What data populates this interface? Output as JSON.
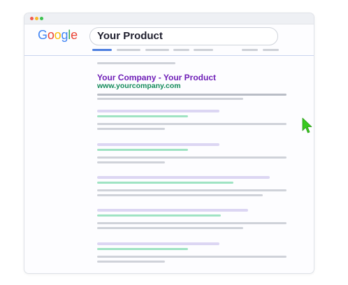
{
  "logo": {
    "letters": [
      "G",
      "o",
      "o",
      "g",
      "l",
      "e"
    ],
    "colors": [
      "#4285F4",
      "#EA4335",
      "#FBBC05",
      "#4285F4",
      "#34A853",
      "#EA4335"
    ]
  },
  "search": {
    "query": "Your Product"
  },
  "top_result": {
    "title": "Your Company - Your Product",
    "url": "www.yourcompany.com"
  },
  "colors": {
    "title": "#6f1fb7",
    "url": "#138a5a",
    "cursor": "#38c91f",
    "active_tab": "#4d7fe0"
  },
  "cursor": {
    "icon": "arrow-cursor-icon"
  }
}
